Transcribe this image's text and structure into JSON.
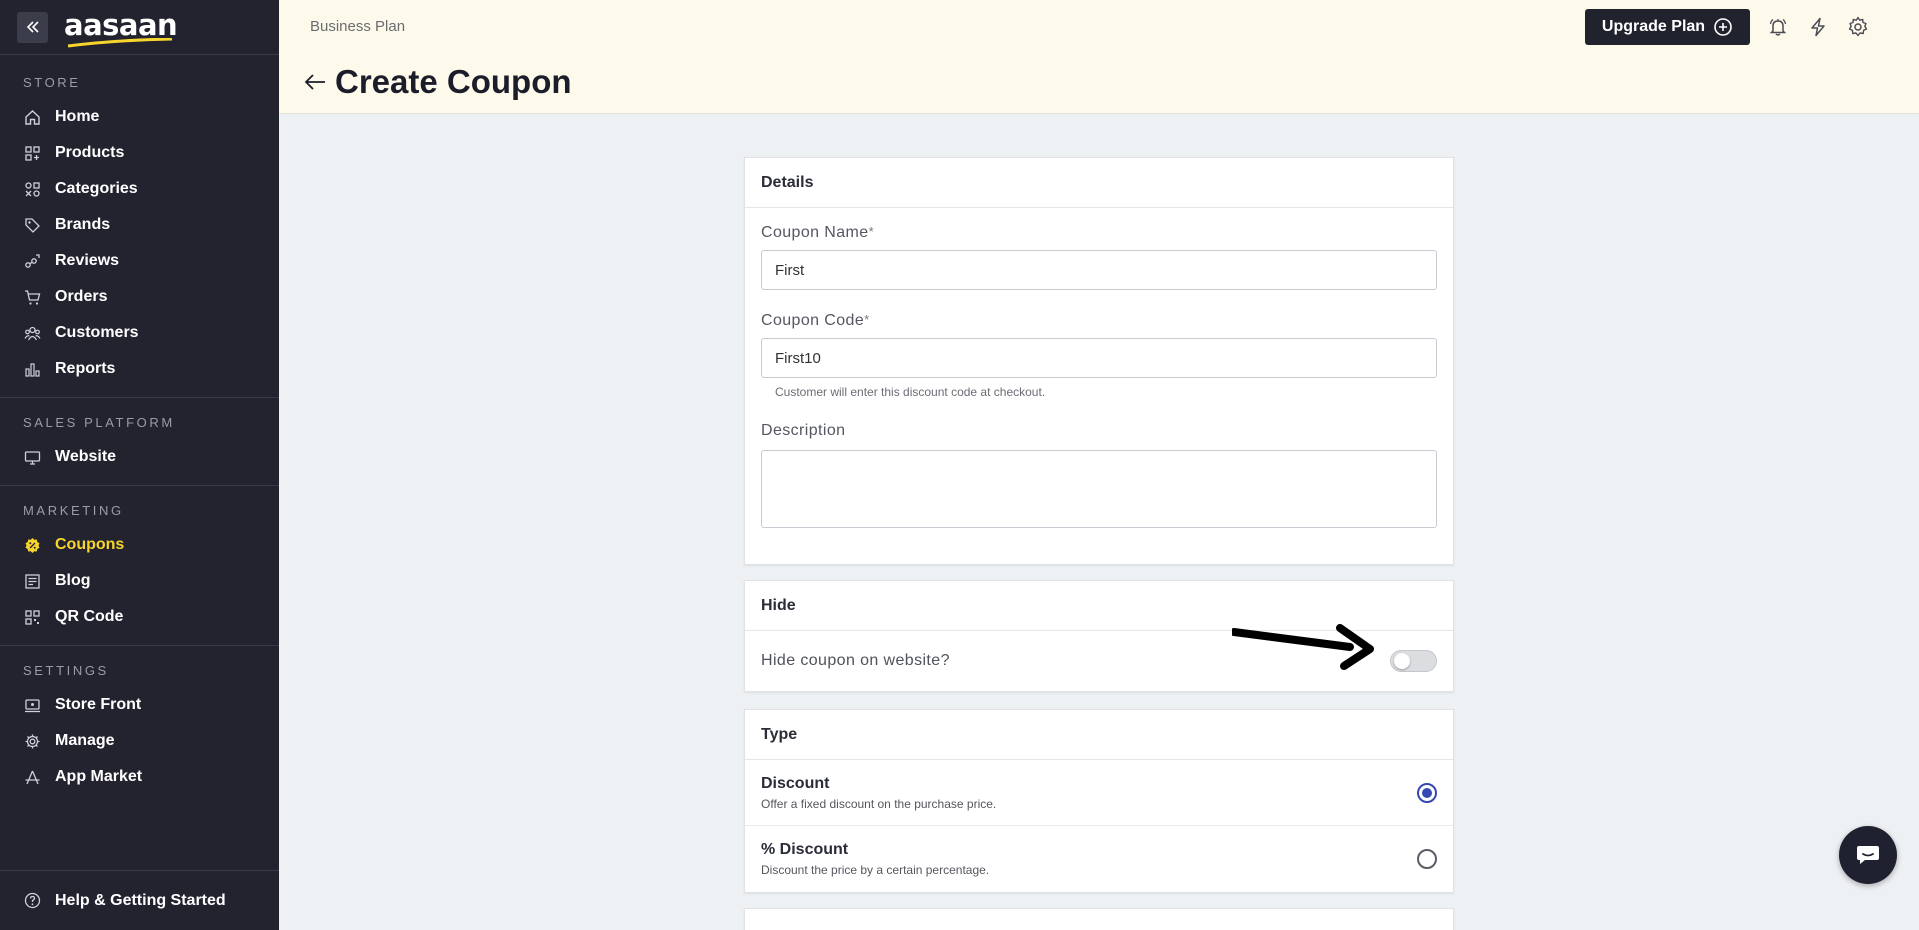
{
  "sidebar": {
    "brand": "aasaan",
    "sections": [
      {
        "heading": "STORE",
        "items": [
          {
            "label": "Home",
            "icon": "home-icon"
          },
          {
            "label": "Products",
            "icon": "products-grid-icon"
          },
          {
            "label": "Categories",
            "icon": "categories-icon"
          },
          {
            "label": "Brands",
            "icon": "tag-icon"
          },
          {
            "label": "Reviews",
            "icon": "reviews-icon"
          },
          {
            "label": "Orders",
            "icon": "cart-icon"
          },
          {
            "label": "Customers",
            "icon": "customers-icon"
          },
          {
            "label": "Reports",
            "icon": "bar-chart-icon"
          }
        ]
      },
      {
        "heading": "SALES PLATFORM",
        "items": [
          {
            "label": "Website",
            "icon": "monitor-icon"
          }
        ]
      },
      {
        "heading": "MARKETING",
        "items": [
          {
            "label": "Coupons",
            "icon": "coupon-badge-icon",
            "active": true
          },
          {
            "label": "Blog",
            "icon": "blog-icon"
          },
          {
            "label": "QR Code",
            "icon": "qr-code-icon"
          }
        ]
      },
      {
        "heading": "SETTINGS",
        "items": [
          {
            "label": "Store Front",
            "icon": "store-front-icon"
          },
          {
            "label": "Manage",
            "icon": "gear-icon"
          },
          {
            "label": "App Market",
            "icon": "app-market-icon"
          }
        ]
      }
    ],
    "help": "Help & Getting Started",
    "active_color": "#f7d52c"
  },
  "header": {
    "plan": "Business Plan",
    "title": "Create Coupon",
    "upgrade_label": "Upgrade Plan"
  },
  "details": {
    "heading": "Details",
    "coupon_name_label": "Coupon Name",
    "coupon_name_value": "First",
    "coupon_code_label": "Coupon Code",
    "coupon_code_value": "First10",
    "coupon_code_helper": "Customer will enter this discount code at checkout.",
    "description_label": "Description",
    "description_value": "",
    "required_mark": "*"
  },
  "hide": {
    "heading": "Hide",
    "toggle_label": "Hide coupon on website?",
    "toggle_on": false
  },
  "type": {
    "heading": "Type",
    "options": [
      {
        "title": "Discount",
        "desc": "Offer a fixed discount on the purchase price.",
        "selected": true
      },
      {
        "title": "% Discount",
        "desc": "Discount the price by a certain percentage.",
        "selected": false
      }
    ]
  },
  "colors": {
    "sidebar_bg": "#22232f",
    "header_bg": "#fefaeb",
    "radio_accent": "#3548b3"
  }
}
